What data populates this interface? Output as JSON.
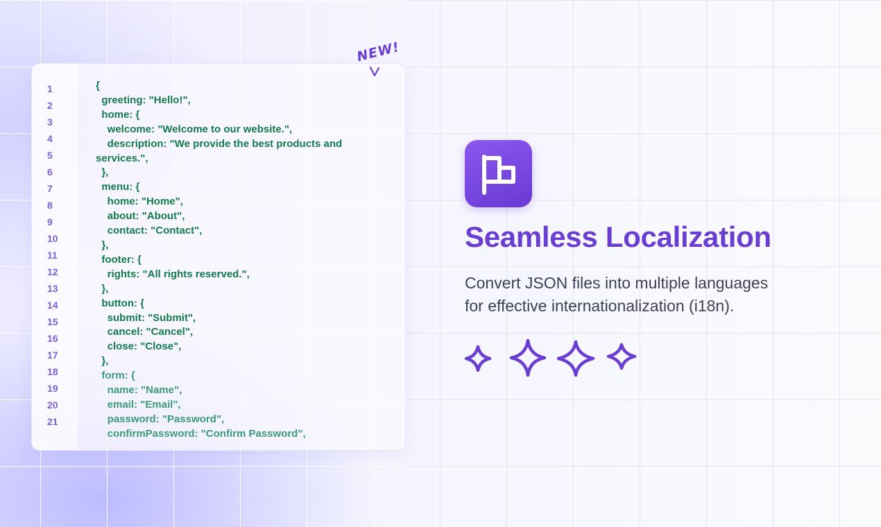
{
  "badge": {
    "label": "NEW!"
  },
  "code_editor": {
    "line_numbers": [
      "1",
      "2",
      "3",
      "4",
      "5",
      "6",
      "7",
      "8",
      "9",
      "10",
      "11",
      "12",
      "13",
      "14",
      "15",
      "16",
      "17",
      "18",
      "19",
      "20",
      "21"
    ],
    "lines": [
      "{",
      "  greeting: \"Hello!\",",
      "  home: {",
      "    welcome: \"Welcome to our website.\",",
      "    description: \"We provide the best products and",
      "services.\",",
      "  },",
      "  menu: {",
      "    home: \"Home\",",
      "    about: \"About\",",
      "    contact: \"Contact\",",
      "  },",
      "  footer: {",
      "    rights: \"All rights reserved.\",",
      "  },",
      "  button: {",
      "    submit: \"Submit\",",
      "    cancel: \"Cancel\",",
      "    close: \"Close\",",
      "  },",
      "  form: {",
      "    name: \"Name\",",
      "    email: \"Email\",",
      "    password: \"Password\",",
      "    confirmPassword: \"Confirm Password\","
    ]
  },
  "feature": {
    "icon": "flag-icon",
    "title": "Seamless Localization",
    "description": " Convert JSON files into multiple languages\nfor effective internationalization (i18n).",
    "sparkle_icons": [
      "sparkle-icon",
      "sparkle-icon",
      "sparkle-icon",
      "sparkle-icon"
    ]
  },
  "colors": {
    "accent": "#6a3ed0",
    "code_text": "#137a4c",
    "line_number": "#7c62d8",
    "description_text": "#3d3f55"
  }
}
